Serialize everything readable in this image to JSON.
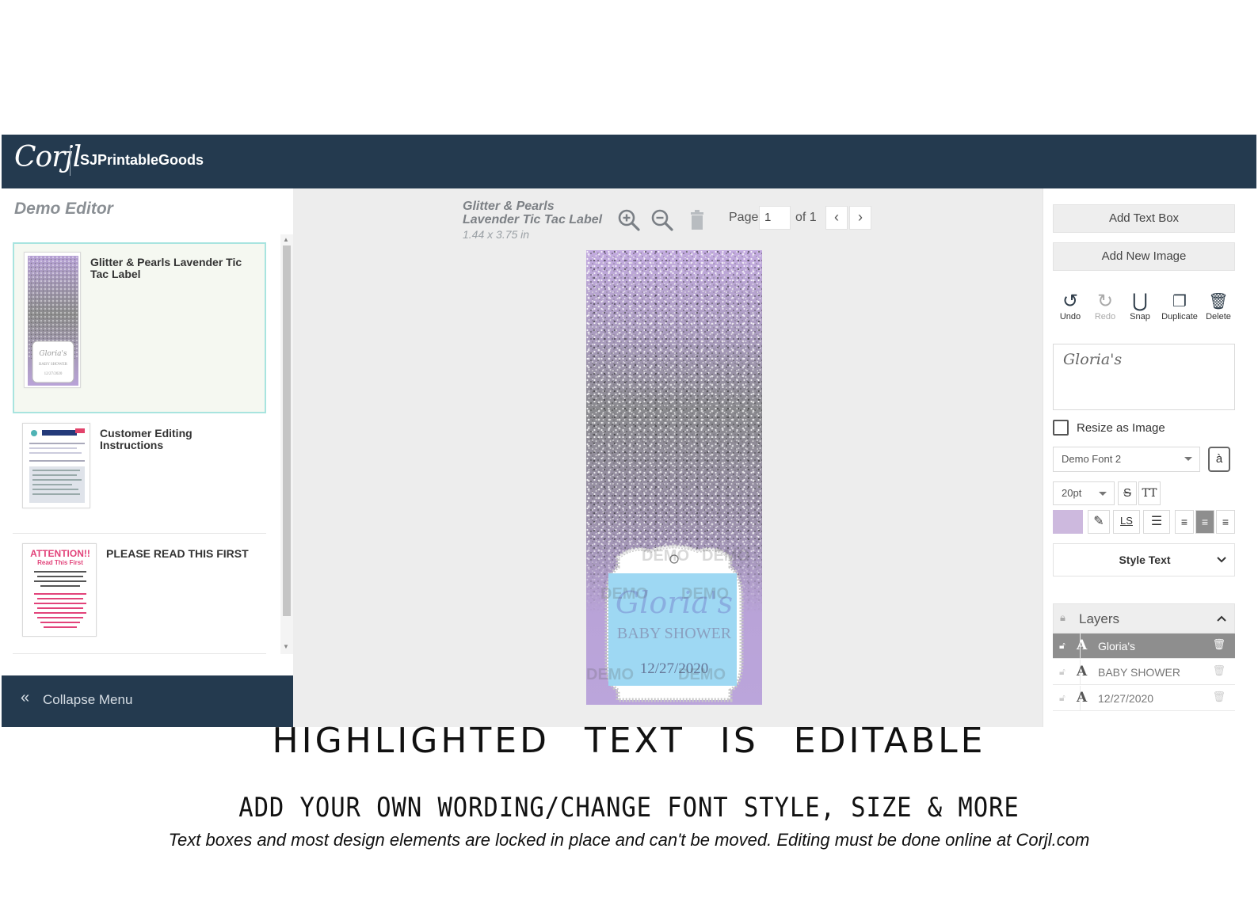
{
  "topbar": {
    "logo": "Corjl",
    "shop_name": "SJPrintableGoods"
  },
  "left_panel": {
    "title": "Demo Editor",
    "pages": [
      {
        "label": "Glitter & Pearls Lavender Tic Tac Label",
        "active": true,
        "thumb_name": "Gloria's",
        "thumb_sub": "BABY SHOWER",
        "thumb_date": "12/27/2020"
      },
      {
        "label": "Customer Editing Instructions",
        "active": false
      },
      {
        "label": "PLEASE READ THIS FIRST",
        "active": false,
        "thumb_title": "ATTENTION!!",
        "thumb_sub": "Read This First"
      }
    ],
    "collapse_label": "Collapse Menu"
  },
  "center": {
    "doc_title_line1": "Glitter & Pearls",
    "doc_title_line2": "Lavender Tic Tac Label",
    "doc_size": "1.44 x 3.75 in",
    "page_label": "Page",
    "page_value": "1",
    "page_of": "of 1",
    "prev": "‹",
    "next": "›",
    "label": {
      "name": "Gloria's",
      "sub": "BABY SHOWER",
      "date": "12/27/2020",
      "watermark": "DEMO"
    }
  },
  "right_panel": {
    "add_text_box": "Add Text Box",
    "add_new_image": "Add New Image",
    "tools": {
      "undo": "Undo",
      "redo": "Redo",
      "snap": "Snap",
      "duplicate": "Duplicate",
      "delete": "Delete"
    },
    "text_value": "Gloria's",
    "resize_as_image": "Resize as Image",
    "font": "Demo Font 2",
    "font_size": "20pt",
    "text_color": "#cdb9de",
    "style_text": "Style Text",
    "layers_title": "Layers",
    "layers": [
      {
        "name": "Gloria's",
        "selected": true
      },
      {
        "name": "BABY SHOWER",
        "selected": false
      },
      {
        "name": "12/27/2020",
        "selected": false
      }
    ]
  },
  "captions": {
    "line1": "HIGHLIGHTED TEXT IS EDITABLE",
    "line2": "ADD YOUR OWN WORDING/CHANGE FONT STYLE, SIZE & MORE",
    "line3": "Text boxes and most design elements are locked in place and can't be moved. Editing must be done online at Corjl.com"
  }
}
